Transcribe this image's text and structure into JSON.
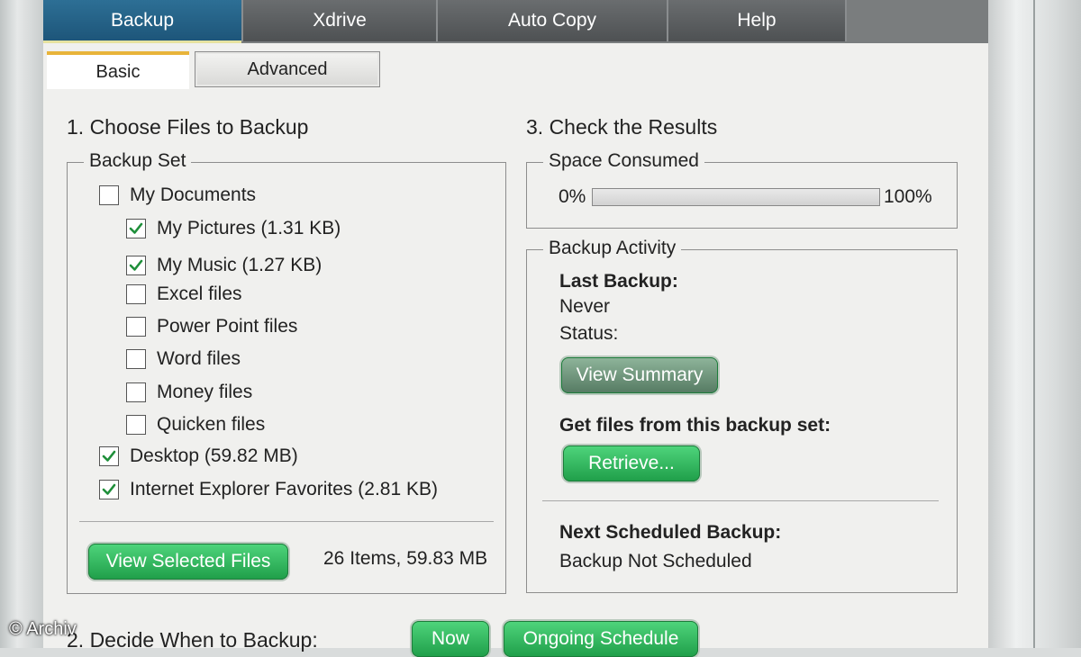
{
  "top_tabs": [
    {
      "label": "Backup",
      "active": true
    },
    {
      "label": "Xdrive",
      "active": false
    },
    {
      "label": "Auto Copy",
      "active": false
    },
    {
      "label": "Help",
      "active": false
    }
  ],
  "sub_tabs": [
    {
      "label": "Basic",
      "active": true
    },
    {
      "label": "Advanced",
      "active": false
    }
  ],
  "choose": {
    "heading": "1. Choose Files to Backup",
    "group_label": "Backup Set",
    "items": [
      {
        "label": "My Documents",
        "checked": false
      },
      {
        "label": "My Pictures (1.31 KB)",
        "checked": true
      },
      {
        "label": "My Music (1.27 KB)",
        "checked": true
      },
      {
        "label": "Excel files",
        "checked": false
      },
      {
        "label": "Power Point files",
        "checked": false
      },
      {
        "label": "Word files",
        "checked": false
      },
      {
        "label": "Money files",
        "checked": false
      },
      {
        "label": "Quicken files",
        "checked": false
      },
      {
        "label": "Desktop (59.82 MB)",
        "checked": true
      },
      {
        "label": "Internet Explorer Favorites (2.81 KB)",
        "checked": true
      }
    ],
    "view_selected_label": "View Selected Files",
    "summary": "26 Items, 59.83 MB"
  },
  "results": {
    "heading": "3. Check the Results",
    "space_label": "Space Consumed",
    "min_label": "0%",
    "max_label": "100%",
    "space_fraction": 0,
    "activity_label": "Backup Activity",
    "last_backup_title": "Last Backup:",
    "last_backup_value": "Never",
    "status_label": "Status:",
    "view_summary_label": "View Summary",
    "get_files_title": "Get files from this backup set:",
    "retrieve_label": "Retrieve...",
    "next_title": "Next Scheduled Backup:",
    "next_value": "Backup Not Scheduled"
  },
  "decide": {
    "heading": "2. Decide When to Backup:",
    "now_label": "Now",
    "schedule_label": "Ongoing Schedule"
  },
  "watermark": "© Archiv",
  "colors": {
    "accent_blue": "#1d5579",
    "button_green": "#1f9e49",
    "tab_underline": "#e8b43a"
  }
}
